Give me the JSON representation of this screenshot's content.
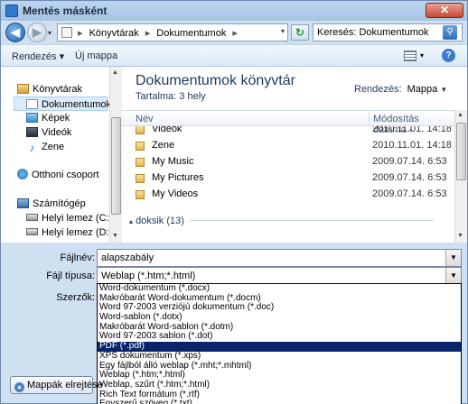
{
  "window": {
    "title": "Mentés másként",
    "close_label": "✕"
  },
  "nav": {
    "back_label": "◀",
    "forward_label": "▶",
    "breadcrumb": [
      "Könyvtárak",
      "Dokumentumok"
    ],
    "search_placeholder": "Keresés: Dokumentumok"
  },
  "toolbar": {
    "organize": "Rendezés ▾",
    "new_folder": "Új mappa",
    "help": "?"
  },
  "sidebar": {
    "items": [
      {
        "label": "Könyvtárak"
      },
      {
        "label": "Dokumentumok"
      },
      {
        "label": "Képek"
      },
      {
        "label": "Videók"
      },
      {
        "label": "Zene"
      },
      {
        "label": "Otthoni csoport"
      },
      {
        "label": "Számítógép"
      },
      {
        "label": "Helyi lemez (C:)"
      },
      {
        "label": "Helyi lemez (D:)"
      }
    ]
  },
  "main": {
    "title": "Dokumentumok könyvtár",
    "subtitle": "Tartalma:  3 hely",
    "arrange_label": "Rendezés:",
    "arrange_value": "Mappa",
    "columns": {
      "name": "Név",
      "modified": "Módosítás dátuma"
    },
    "rows": [
      {
        "name": "Videók",
        "date": "2010.11.01. 14:18"
      },
      {
        "name": "Zene",
        "date": "2010.11.01. 14:18"
      },
      {
        "name": "My Music",
        "date": "2009.07.14. 6:53"
      },
      {
        "name": "My Pictures",
        "date": "2009.07.14. 6:53"
      },
      {
        "name": "My Videos",
        "date": "2009.07.14. 6:53"
      }
    ],
    "group_label": "doksik (13)"
  },
  "form": {
    "filename_label": "Fájlnév:",
    "filename_value": "alapszabály",
    "filetype_label": "Fájl típusa:",
    "filetype_value": "Weblap (*.htm;*.html)",
    "authors_label": "Szerzők:",
    "filetype_options": [
      "Word-dokumentum (*.docx)",
      "Makróbarát Word-dokumentum (*.docm)",
      "Word 97-2003 verziójú dokumentum (*.doc)",
      "Word-sablon (*.dotx)",
      "Makróbarát Word-sablon (*.dotm)",
      "Word 97-2003 sablon (*.dot)",
      "PDF (*.pdf)",
      "XPS dokumentum (*.xps)",
      "Egy fájlból álló weblap (*.mht;*.mhtml)",
      "Weblap (*.htm;*.html)",
      "Weblap, szűrt (*.htm;*.html)",
      "Rich Text formátum (*.rtf)",
      "Egyszerű szöveg (*.txt)"
    ],
    "selected_option_index": 6,
    "hide_folders": "Mappák elrejtése"
  }
}
